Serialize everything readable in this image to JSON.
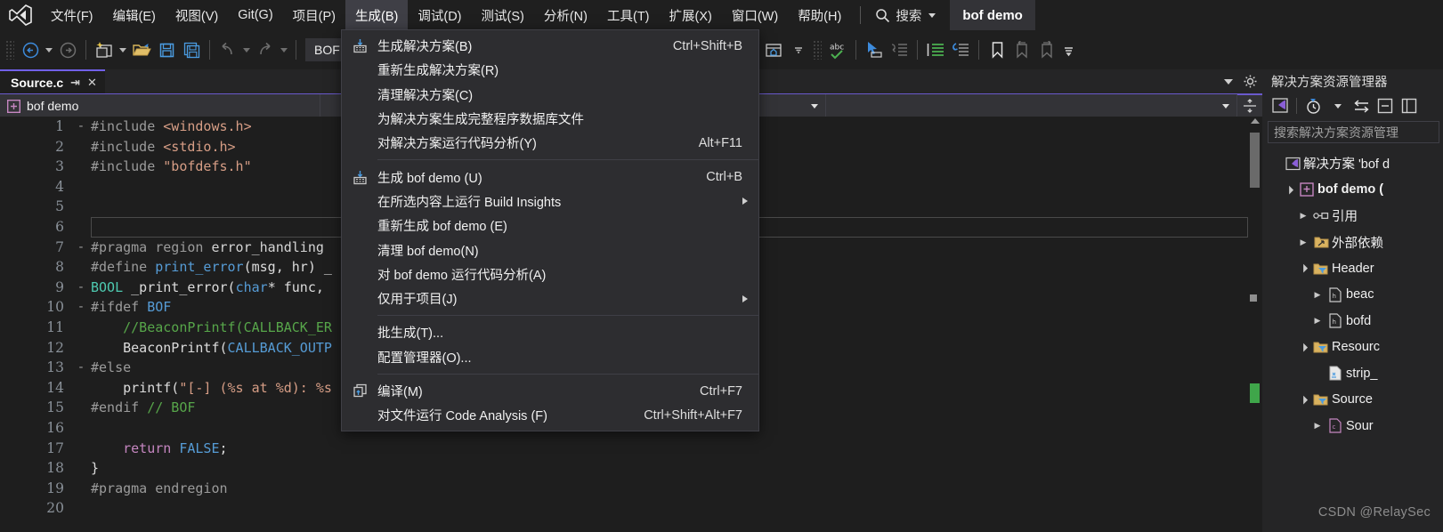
{
  "window": {
    "project_title": "bof demo",
    "watermark": "CSDN @RelaySec"
  },
  "menubar": {
    "logo_icon": "visual-studio-logo-icon",
    "items": [
      {
        "label": "文件(F)",
        "active": false
      },
      {
        "label": "编辑(E)",
        "active": false
      },
      {
        "label": "视图(V)",
        "active": false
      },
      {
        "label": "Git(G)",
        "active": false
      },
      {
        "label": "项目(P)",
        "active": false
      },
      {
        "label": "生成(B)",
        "active": true
      },
      {
        "label": "调试(D)",
        "active": false
      },
      {
        "label": "测试(S)",
        "active": false
      },
      {
        "label": "分析(N)",
        "active": false
      },
      {
        "label": "工具(T)",
        "active": false
      },
      {
        "label": "扩展(X)",
        "active": false
      },
      {
        "label": "窗口(W)",
        "active": false
      },
      {
        "label": "帮助(H)",
        "active": false
      }
    ],
    "search": {
      "icon": "search-icon",
      "label": "搜索",
      "caret_icon": "chevron-down-icon"
    }
  },
  "toolbar": {
    "configuration_value": "BOF",
    "buttons": [
      {
        "name": "navigate-back-button",
        "icon": "arrow-left-circle-icon"
      },
      {
        "name": "navigate-back-dropdown",
        "icon": "chevron-down-icon"
      },
      {
        "name": "navigate-forward-button",
        "icon": "arrow-right-circle-icon"
      },
      {
        "name": "new-project-button",
        "icon": "new-project-icon"
      },
      {
        "name": "new-project-dropdown",
        "icon": "chevron-down-icon"
      },
      {
        "name": "open-file-button",
        "icon": "open-folder-icon"
      },
      {
        "name": "save-button",
        "icon": "save-icon"
      },
      {
        "name": "save-all-button",
        "icon": "save-all-icon"
      },
      {
        "name": "undo-button",
        "icon": "undo-icon"
      },
      {
        "name": "undo-dropdown",
        "icon": "chevron-down-icon"
      },
      {
        "name": "redo-button",
        "icon": "redo-icon"
      },
      {
        "name": "redo-dropdown",
        "icon": "chevron-down-icon"
      }
    ],
    "right_buttons": [
      {
        "name": "preview-window-button",
        "icon": "window-preview-icon"
      },
      {
        "name": "preview-window-dropdown",
        "icon": "chevron-down-icon"
      },
      {
        "name": "spellcheck-button",
        "icon": "abc-checkmark-icon"
      },
      {
        "name": "pointer-select-button",
        "icon": "pointer-icon"
      },
      {
        "name": "indent-block-button",
        "icon": "indent-right-icon"
      },
      {
        "name": "comment-lines-button",
        "icon": "comment-lines-icon"
      },
      {
        "name": "uncomment-lines-button",
        "icon": "uncomment-lines-icon"
      },
      {
        "name": "toggle-bookmark-button",
        "icon": "bookmark-icon"
      },
      {
        "name": "previous-bookmark-button",
        "icon": "bookmark-prev-icon"
      },
      {
        "name": "next-bookmark-button",
        "icon": "bookmark-next-icon"
      },
      {
        "name": "toolbar-overflow-button",
        "icon": "overflow-chevron-icon"
      }
    ]
  },
  "build_menu": {
    "groups": [
      {
        "items": [
          {
            "label": "生成解决方案(B)",
            "shortcut": "Ctrl+Shift+B",
            "icon": "build-solution-icon",
            "submenu": false
          },
          {
            "label": "重新生成解决方案(R)",
            "shortcut": "",
            "icon": "",
            "submenu": false
          },
          {
            "label": "清理解决方案(C)",
            "shortcut": "",
            "icon": "",
            "submenu": false
          },
          {
            "label": "为解决方案生成完整程序数据库文件",
            "shortcut": "",
            "icon": "",
            "submenu": false
          },
          {
            "label": "对解决方案运行代码分析(Y)",
            "shortcut": "Alt+F11",
            "icon": "",
            "submenu": false
          }
        ]
      },
      {
        "items": [
          {
            "label": "生成 bof demo (U)",
            "shortcut": "Ctrl+B",
            "icon": "build-project-icon",
            "submenu": false
          },
          {
            "label": "在所选内容上运行 Build Insights",
            "shortcut": "",
            "icon": "",
            "submenu": true
          },
          {
            "label": "重新生成 bof demo (E)",
            "shortcut": "",
            "icon": "",
            "submenu": false
          },
          {
            "label": "清理 bof demo(N)",
            "shortcut": "",
            "icon": "",
            "submenu": false
          },
          {
            "label": "对 bof demo 运行代码分析(A)",
            "shortcut": "",
            "icon": "",
            "submenu": false
          },
          {
            "label": "仅用于项目(J)",
            "shortcut": "",
            "icon": "",
            "submenu": true
          }
        ]
      },
      {
        "items": [
          {
            "label": "批生成(T)...",
            "shortcut": "",
            "icon": "",
            "submenu": false
          },
          {
            "label": "配置管理器(O)...",
            "shortcut": "",
            "icon": "",
            "submenu": false
          }
        ]
      },
      {
        "items": [
          {
            "label": "编译(M)",
            "shortcut": "Ctrl+F7",
            "icon": "compile-icon",
            "submenu": false
          },
          {
            "label": "对文件运行 Code Analysis (F)",
            "shortcut": "Ctrl+Shift+Alt+F7",
            "icon": "",
            "submenu": false
          }
        ]
      }
    ]
  },
  "editor": {
    "tab": {
      "filename": "Source.c",
      "pin_icon": "pin-icon",
      "close_icon": "close-icon"
    },
    "navbar": {
      "project_label": "bof demo",
      "project_icon": "cpp-project-icon",
      "member_dropdown": "",
      "scope_dropdown": ""
    },
    "lines": [
      {
        "n": "1",
        "fold": "-",
        "tokens": [
          {
            "t": "#include ",
            "c": "t-pre"
          },
          {
            "t": "<windows.h>",
            "c": "t-str"
          }
        ]
      },
      {
        "n": "2",
        "fold": "",
        "tokens": [
          {
            "t": "#include ",
            "c": "t-pre"
          },
          {
            "t": "<stdio.h>",
            "c": "t-str"
          }
        ]
      },
      {
        "n": "3",
        "fold": "",
        "tokens": [
          {
            "t": "#include ",
            "c": "t-pre"
          },
          {
            "t": "\"bofdefs.h\"",
            "c": "t-str"
          }
        ]
      },
      {
        "n": "4",
        "fold": "",
        "tokens": []
      },
      {
        "n": "5",
        "fold": "",
        "tokens": []
      },
      {
        "n": "6",
        "fold": "",
        "tokens": []
      },
      {
        "n": "7",
        "fold": "-",
        "tokens": [
          {
            "t": "#pragma region ",
            "c": "t-pre"
          },
          {
            "t": "error_handling",
            "c": "t-white"
          }
        ]
      },
      {
        "n": "8",
        "fold": "",
        "tokens": [
          {
            "t": "#define ",
            "c": "t-pre"
          },
          {
            "t": "print_error",
            "c": "t-kw"
          },
          {
            "t": "(msg, hr) _",
            "c": "t-plain"
          }
        ]
      },
      {
        "n": "9",
        "fold": "-",
        "tokens": [
          {
            "t": "BOOL",
            "c": "t-type"
          },
          {
            "t": " _print_error(",
            "c": "t-plain"
          },
          {
            "t": "char",
            "c": "t-kw"
          },
          {
            "t": "* func,",
            "c": "t-plain"
          }
        ]
      },
      {
        "n": "10",
        "fold": "-",
        "tokens": [
          {
            "t": "#ifdef ",
            "c": "t-pre"
          },
          {
            "t": "BOF",
            "c": "t-kw"
          }
        ]
      },
      {
        "n": "11",
        "fold": "",
        "tokens": [
          {
            "t": "    //BeaconPrintf(CALLBACK_ER",
            "c": "t-cmt"
          }
        ]
      },
      {
        "n": "12",
        "fold": "",
        "tokens": [
          {
            "t": "    BeaconPrintf(",
            "c": "t-plain"
          },
          {
            "t": "CALLBACK_OUTP",
            "c": "t-kw"
          }
        ]
      },
      {
        "n": "13",
        "fold": "-",
        "tokens": [
          {
            "t": "#else",
            "c": "t-pre"
          }
        ]
      },
      {
        "n": "14",
        "fold": "",
        "tokens": [
          {
            "t": "    printf(",
            "c": "t-plain"
          },
          {
            "t": "\"[-] (%s at %d): %s",
            "c": "t-str"
          }
        ]
      },
      {
        "n": "15",
        "fold": "",
        "tokens": [
          {
            "t": "#endif ",
            "c": "t-pre"
          },
          {
            "t": "// BOF",
            "c": "t-cmt"
          }
        ]
      },
      {
        "n": "16",
        "fold": "",
        "tokens": []
      },
      {
        "n": "17",
        "fold": "",
        "tokens": [
          {
            "t": "    ",
            "c": "t-plain"
          },
          {
            "t": "return",
            "c": "t-kw2"
          },
          {
            "t": " ",
            "c": "t-plain"
          },
          {
            "t": "FALSE",
            "c": "t-kw"
          },
          {
            "t": ";",
            "c": "t-plain"
          }
        ]
      },
      {
        "n": "18",
        "fold": "",
        "tokens": [
          {
            "t": "}",
            "c": "t-plain"
          }
        ]
      },
      {
        "n": "19",
        "fold": "",
        "tokens": [
          {
            "t": "#pragma endregion",
            "c": "t-pre"
          }
        ]
      },
      {
        "n": "20",
        "fold": "",
        "tokens": []
      }
    ],
    "current_line": 6
  },
  "solution_explorer": {
    "title": "解决方案资源管理器",
    "search_placeholder": "搜索解决方案资源管理",
    "tools": [
      {
        "name": "solution-home-button",
        "icon": "solution-vs-icon"
      },
      {
        "name": "pending-changes-button",
        "icon": "clock-icon"
      },
      {
        "name": "pending-changes-dropdown",
        "icon": "chevron-down-icon"
      },
      {
        "name": "sync-views-button",
        "icon": "sync-arrows-icon"
      },
      {
        "name": "collapse-all-button",
        "icon": "collapse-all-icon"
      },
      {
        "name": "properties-button",
        "icon": "properties-icon"
      }
    ],
    "tree": [
      {
        "indent": 0,
        "expander": "",
        "icon": "solution-icon",
        "label": "解决方案 'bof d",
        "bold": false
      },
      {
        "indent": 1,
        "expander": "▲",
        "icon": "cpp-project-icon",
        "label": "bof demo (",
        "bold": true
      },
      {
        "indent": 2,
        "expander": "▶",
        "icon": "references-icon",
        "label": "引用",
        "bold": false
      },
      {
        "indent": 2,
        "expander": "▶",
        "icon": "folder-ext-icon",
        "label": "外部依赖",
        "bold": false
      },
      {
        "indent": 2,
        "expander": "▲",
        "icon": "filter-folder-icon",
        "label": "Header",
        "bold": false
      },
      {
        "indent": 3,
        "expander": "▶",
        "icon": "header-file-icon",
        "label": "beac",
        "bold": false
      },
      {
        "indent": 3,
        "expander": "▶",
        "icon": "header-file-icon",
        "label": "bofd",
        "bold": false
      },
      {
        "indent": 2,
        "expander": "▲",
        "icon": "filter-folder-icon",
        "label": "Resourc",
        "bold": false
      },
      {
        "indent": 3,
        "expander": "",
        "icon": "text-file-icon",
        "label": "strip_",
        "bold": false
      },
      {
        "indent": 2,
        "expander": "▲",
        "icon": "filter-folder-icon",
        "label": "Source ",
        "bold": false
      },
      {
        "indent": 3,
        "expander": "▶",
        "icon": "c-file-icon",
        "label": "Sour",
        "bold": false
      }
    ]
  }
}
